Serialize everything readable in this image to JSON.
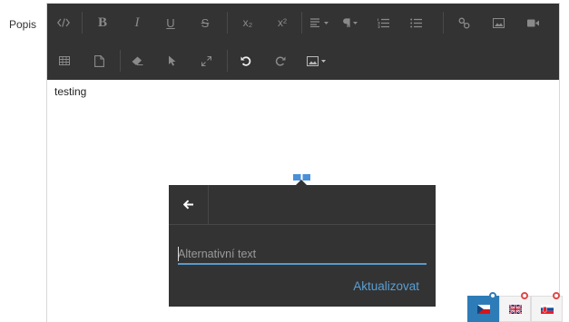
{
  "field": {
    "label": "Popis"
  },
  "toolbar": {
    "row1": [
      "code-view",
      "bold",
      "italic",
      "underline",
      "strikethrough",
      "subscript",
      "superscript",
      "align",
      "paragraph",
      "ordered-list",
      "unordered-list",
      "link",
      "image",
      "video"
    ],
    "row2": [
      "table",
      "file",
      "clear-formatting",
      "select",
      "fullscreen",
      "undo",
      "redo",
      "image-options"
    ],
    "glyphs": {
      "bold": "B",
      "italic": "I",
      "underline": "U",
      "strikethrough": "S",
      "subscript": "x₂",
      "superscript": "x²"
    }
  },
  "editor": {
    "content": "testing"
  },
  "popover": {
    "back_icon": "arrow-left-icon",
    "alt_input": {
      "value": "",
      "placeholder": "Alternativní text"
    },
    "update_label": "Aktualizovat"
  },
  "languages": [
    {
      "code": "cs",
      "icon": "flag-cz-icon",
      "active": true
    },
    {
      "code": "en",
      "icon": "flag-gb-icon",
      "active": false
    },
    {
      "code": "sk",
      "icon": "flag-sk-icon",
      "active": false
    }
  ],
  "colors": {
    "toolbar_bg": "#333333",
    "accent": "#5a9fd4",
    "active_lang": "#2d7cb8"
  }
}
